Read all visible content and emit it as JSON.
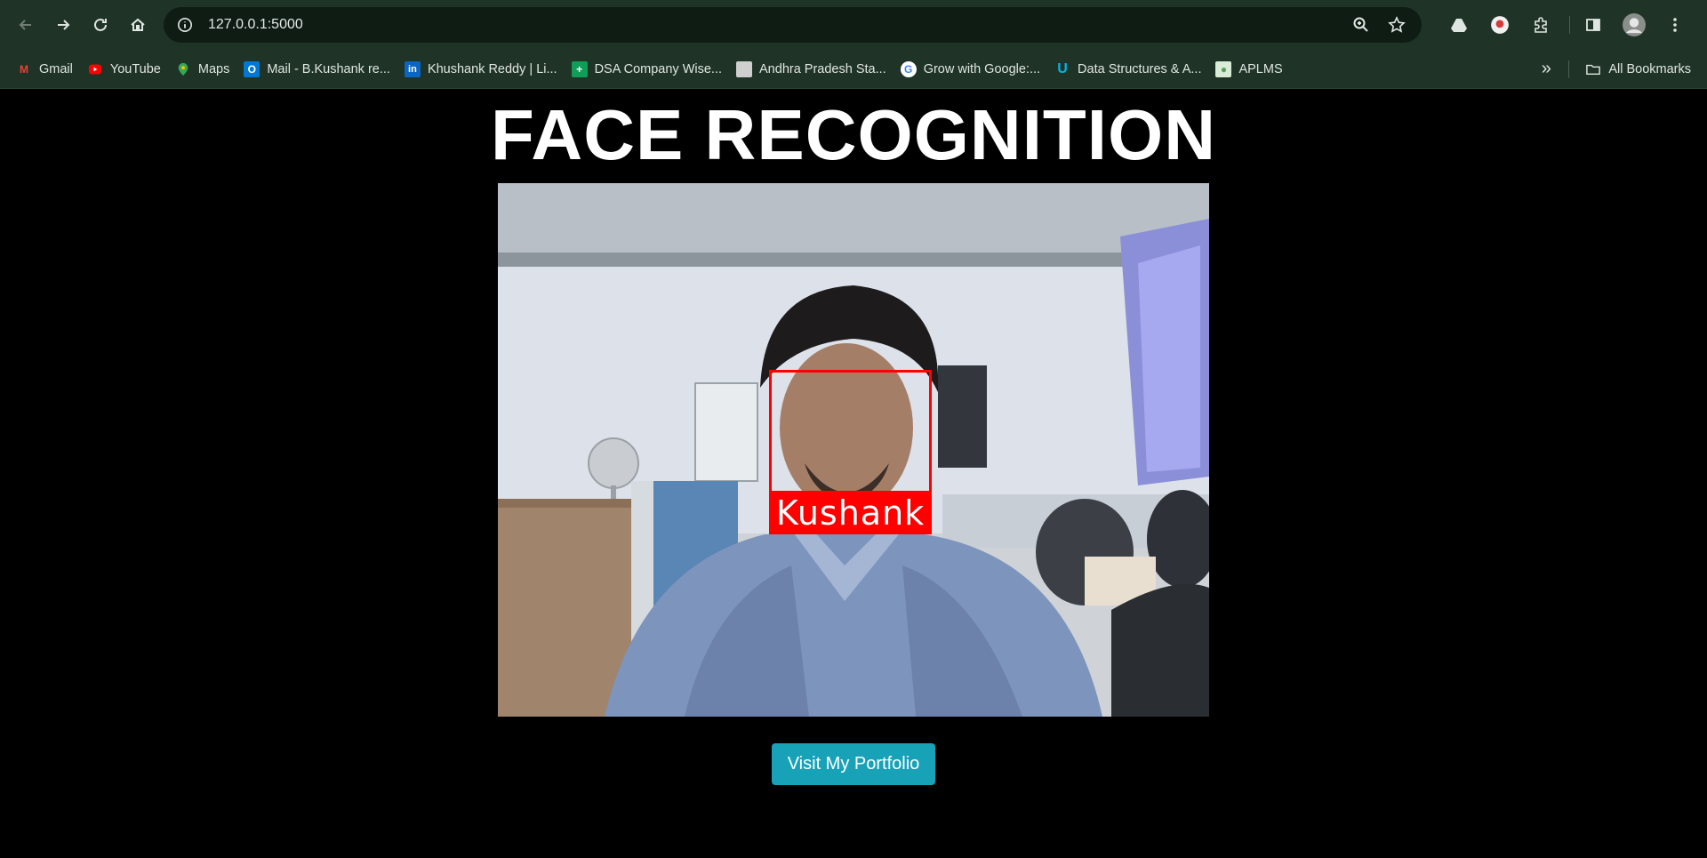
{
  "browser": {
    "url": "127.0.0.1:5000",
    "bookmarks": [
      {
        "label": "Gmail",
        "icon": "gmail-icon",
        "color": "#ea4335"
      },
      {
        "label": "YouTube",
        "icon": "youtube-icon",
        "color": "#ff0000"
      },
      {
        "label": "Maps",
        "icon": "maps-icon",
        "color": "#34a853"
      },
      {
        "label": "Mail - B.Kushank re...",
        "icon": "outlook-icon",
        "color": "#0078d4"
      },
      {
        "label": "Khushank Reddy | Li...",
        "icon": "linkedin-icon",
        "color": "#0a66c2"
      },
      {
        "label": "DSA Company Wise...",
        "icon": "sheets-icon",
        "color": "#0f9d58"
      },
      {
        "label": "Andhra Pradesh Sta...",
        "icon": "ap-icon",
        "color": "#cccccc"
      },
      {
        "label": "Grow with Google:...",
        "icon": "google-icon",
        "color": "#4285f4"
      },
      {
        "label": "Data Structures & A...",
        "icon": "udacity-icon",
        "color": "#02b3e4"
      },
      {
        "label": "APLMS",
        "icon": "aplms-icon",
        "color": "#5aa05a"
      }
    ],
    "all_bookmarks_label": "All Bookmarks"
  },
  "page": {
    "title": "FACE RECOGNITION",
    "detected_name": "Kushank",
    "portfolio_button": "Visit My Portfolio"
  },
  "colors": {
    "chrome_bg": "#1f3327",
    "omnibox_bg": "#0f1c14",
    "page_bg": "#000000",
    "face_box": "#ff0000",
    "button_bg": "#17a2b8"
  }
}
